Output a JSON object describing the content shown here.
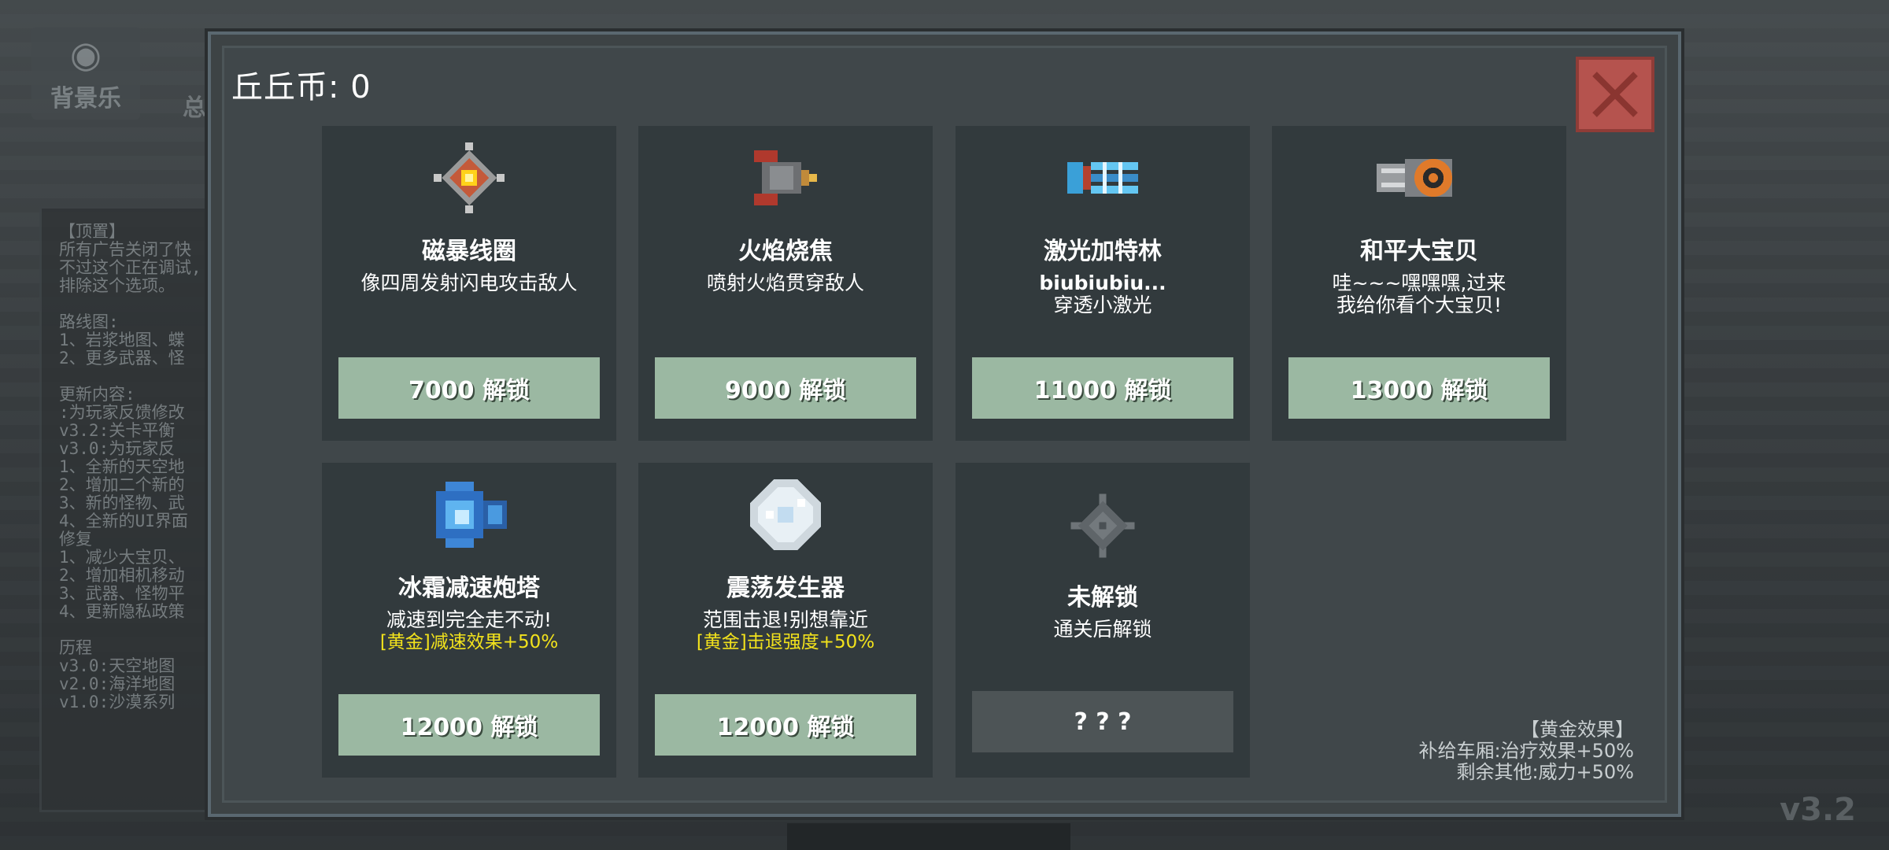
{
  "background": {
    "music_label": "背景乐",
    "total_label": "总",
    "notes": [
      "【顶置】",
      "所有广告关闭了快",
      "不过这个正在调试,",
      "排除这个选项。",
      "",
      "路线图:",
      "1、岩浆地图、蝶",
      "2、更多武器、怪",
      "",
      "更新内容:",
      ":为玩家反馈修改",
      "v3.2:关卡平衡",
      "v3.0:为玩家反",
      "1、全新的天空地",
      "2、增加二个新的",
      "3、新的怪物、武",
      "4、全新的UI界面",
      "修复",
      "1、减少大宝贝、",
      "2、增加相机移动",
      "3、武器、怪物平",
      "4、更新隐私政策",
      "",
      "历程",
      "v3.0:天空地图",
      "v2.0:海洋地图",
      "v1.0:沙漠系列"
    ],
    "version": "v3.2"
  },
  "modal": {
    "coins_label": "丘丘币:",
    "coins_value": "0",
    "cards": [
      {
        "name": "磁暴线圈",
        "desc": "像四周发射闪电攻击敌人",
        "gold": "",
        "button": "7000 解锁",
        "icon": "tesla-coil-icon"
      },
      {
        "name": "火焰烧焦",
        "desc": "喷射火焰贯穿敌人",
        "gold": "",
        "button": "9000 解锁",
        "icon": "flamethrower-icon"
      },
      {
        "name": "激光加特林",
        "desc": "biubiubiu...\n穿透小激光",
        "gold": "",
        "button": "11000 解锁",
        "icon": "laser-gatling-icon"
      },
      {
        "name": "和平大宝贝",
        "desc": "哇~~~嘿嘿嘿,过来\n我给你看个大宝贝!",
        "gold": "",
        "button": "13000 解锁",
        "icon": "nuke-launcher-icon"
      },
      {
        "name": "冰霜减速炮塔",
        "desc": "减速到完全走不动!",
        "gold": "[黄金]减速效果+50%",
        "button": "12000 解锁",
        "icon": "frost-turret-icon"
      },
      {
        "name": "震荡发生器",
        "desc": "范围击退!别想靠近",
        "gold": "[黄金]击退强度+50%",
        "button": "12000 解锁",
        "icon": "shockwave-generator-icon"
      },
      {
        "name": "未解锁",
        "desc": "通关后解锁",
        "gold": "",
        "button": "? ? ?",
        "icon": "locked-gear-icon"
      }
    ],
    "gold_effect": {
      "title": "【黄金效果】",
      "line1": "补给车厢:治疗效果+50%",
      "line2": "剩余其他:威力+50%"
    }
  },
  "colors": {
    "card_bg": "#323a3d",
    "button_green": "#9bb8a2",
    "close_red": "#b5534e",
    "gold_text": "#f2e21c"
  }
}
